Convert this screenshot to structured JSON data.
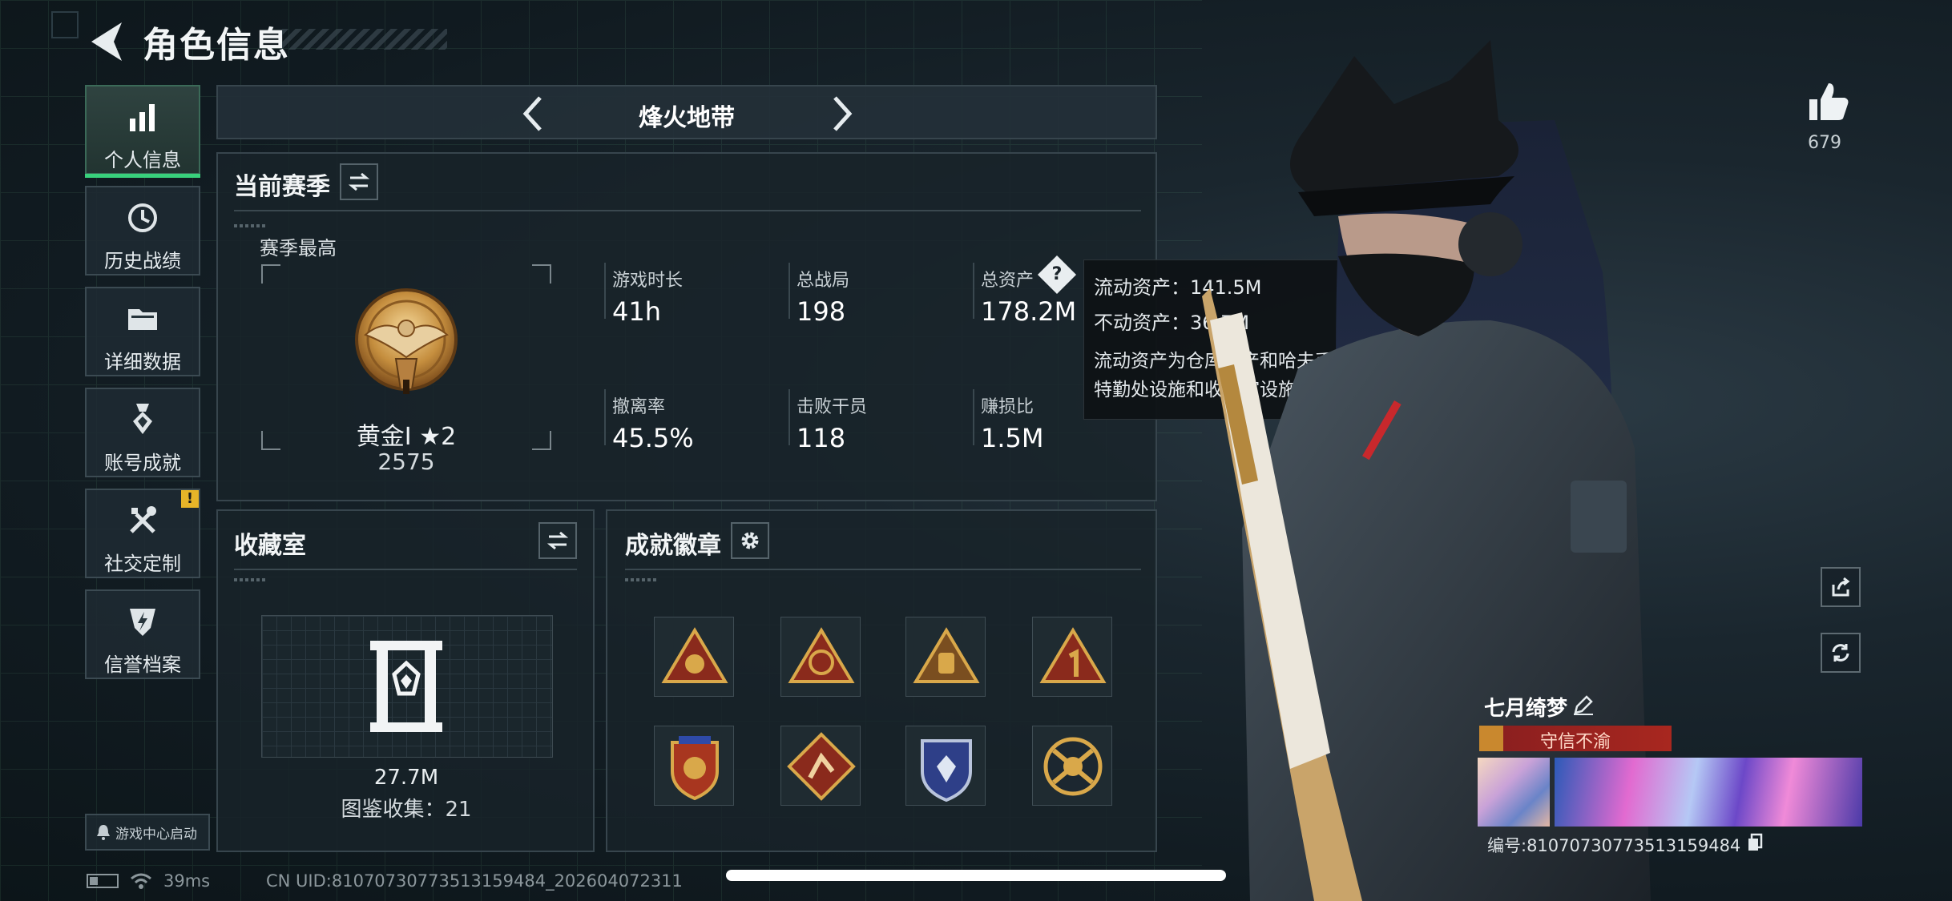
{
  "header": {
    "title": "角色信息"
  },
  "nav": [
    {
      "label": "个人信息",
      "icon": "bar-chart-icon",
      "active": true
    },
    {
      "label": "历史战绩",
      "icon": "history-icon"
    },
    {
      "label": "详细数据",
      "icon": "folder-icon"
    },
    {
      "label": "账号成就",
      "icon": "medal-icon"
    },
    {
      "label": "社交定制",
      "icon": "tools-icon",
      "badge": "!"
    },
    {
      "label": "信誉档案",
      "icon": "shield-bolt-icon"
    }
  ],
  "launch_label": "游戏中心启动",
  "mode": {
    "name": "烽火地带"
  },
  "season": {
    "title": "当前赛季",
    "best_label": "赛季最高",
    "rank": "黄金I ★2",
    "score": "2575",
    "stats": [
      {
        "label": "游戏时长",
        "value": "41h"
      },
      {
        "label": "总战局",
        "value": "198"
      },
      {
        "label": "总资产",
        "value": "178.2M"
      },
      {
        "label": "撤离率",
        "value": "45.5%"
      },
      {
        "label": "击败干员",
        "value": "118"
      },
      {
        "label": "赚损比",
        "value": "1.5M"
      }
    ],
    "help_icon": "?"
  },
  "tooltip": {
    "liquid": "流动资产：141.5M",
    "fixed": "不动资产：36.7M",
    "desc1": "流动资产为仓库资产和哈夫币，不动资产为",
    "desc2": "特勤处设施和收藏室设施"
  },
  "collection": {
    "title": "收藏室",
    "value": "27.7M",
    "count": "图鉴收集：21"
  },
  "achievements": {
    "title": "成就徽章",
    "badges": [
      "triangle-badge-icon",
      "triangle-badge-icon",
      "triangle-badge-icon",
      "triangle-badge-icon",
      "shield-badge-icon",
      "diamond-badge-icon",
      "shield-badge-icon",
      "emblem-badge-icon"
    ]
  },
  "likes": {
    "count": "679"
  },
  "profile": {
    "name": "七月绮梦",
    "honor": "守信不渝",
    "id": "编号:8107073077351315948​4"
  },
  "status": {
    "ping": "39ms",
    "uid": "CN UID:8107073077351315948​4_202604072311"
  },
  "colors": {
    "accent_green": "#38d17c",
    "badge_gold": "#c9962c",
    "honor_red": "#a8271f"
  }
}
